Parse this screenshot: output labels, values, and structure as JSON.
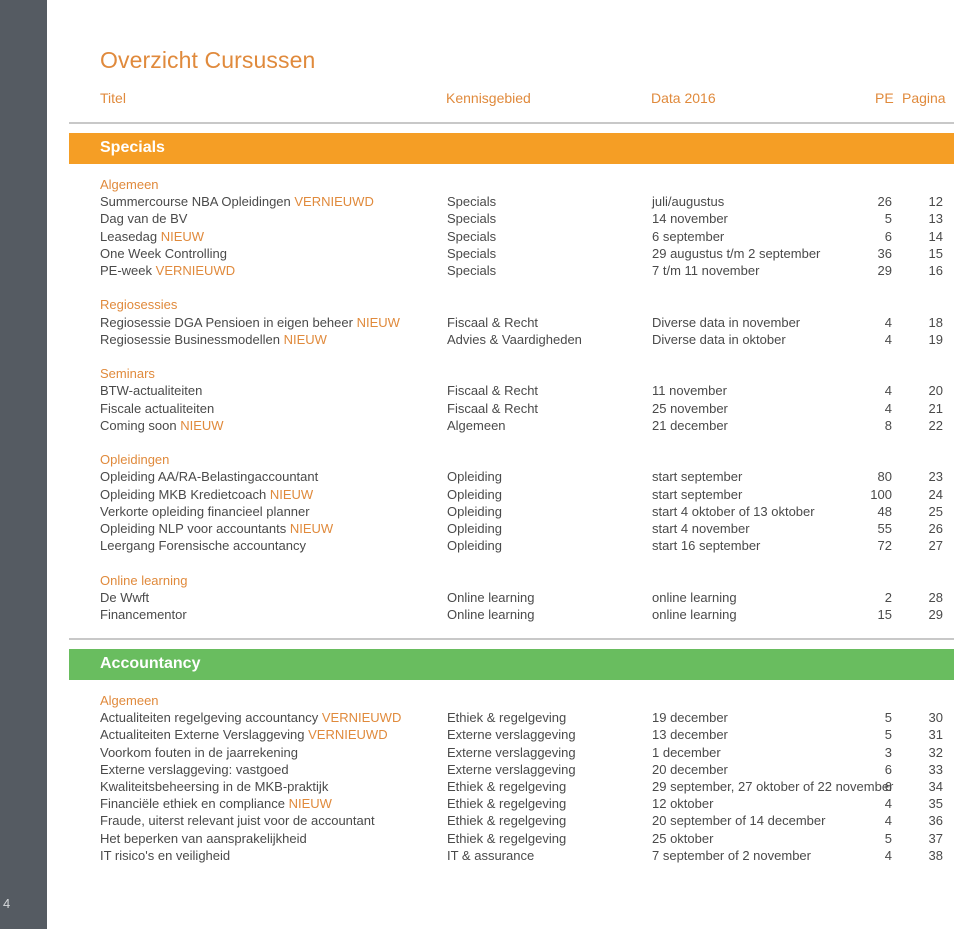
{
  "page_number": "4",
  "title": "Overzicht Cursussen",
  "columns": {
    "title": "Titel",
    "area": "Kennisgebied",
    "dates": "Data 2016",
    "pe": "PE",
    "page": "Pagina"
  },
  "colors": {
    "accent_orange": "#e08a3c",
    "specials_band": "#f59e25",
    "accountancy_band": "#69bd5f",
    "sidebar": "#555b62"
  },
  "sections": [
    {
      "name": "Specials",
      "groups": [
        {
          "name": "Algemeen",
          "rows": [
            {
              "title": "Summercourse NBA Opleidingen",
              "tag": "VERNIEUWD",
              "area": "Specials",
              "date": "juli/augustus",
              "pe": "26",
              "page": "12"
            },
            {
              "title": "Dag van de BV",
              "tag": "",
              "area": "Specials",
              "date": "14 november",
              "pe": "5",
              "page": "13"
            },
            {
              "title": "Leasedag",
              "tag": "NIEUW",
              "area": "Specials",
              "date": "6 september",
              "pe": "6",
              "page": "14"
            },
            {
              "title": "One Week Controlling",
              "tag": "",
              "area": "Specials",
              "date": "29 augustus t/m 2 september",
              "pe": "36",
              "page": "15"
            },
            {
              "title": "PE-week",
              "tag": "VERNIEUWD",
              "area": "Specials",
              "date": "7 t/m 11 november",
              "pe": "29",
              "page": "16"
            }
          ]
        },
        {
          "name": "Regiosessies",
          "rows": [
            {
              "title": "Regiosessie DGA Pensioen in eigen beheer",
              "tag": "NIEUW",
              "area": "Fiscaal & Recht",
              "date": "Diverse data in november",
              "pe": "4",
              "page": "18"
            },
            {
              "title": "Regiosessie Businessmodellen",
              "tag": "NIEUW",
              "area": "Advies & Vaardigheden",
              "date": "Diverse data in oktober",
              "pe": "4",
              "page": "19"
            }
          ]
        },
        {
          "name": "Seminars",
          "rows": [
            {
              "title": "BTW-actualiteiten",
              "tag": "",
              "area": "Fiscaal & Recht",
              "date": "11 november",
              "pe": "4",
              "page": "20"
            },
            {
              "title": "Fiscale actualiteiten",
              "tag": "",
              "area": "Fiscaal & Recht",
              "date": "25 november",
              "pe": "4",
              "page": "21"
            },
            {
              "title": "Coming soon",
              "tag": "NIEUW",
              "area": "Algemeen",
              "date": "21 december",
              "pe": "8",
              "page": "22"
            }
          ]
        },
        {
          "name": "Opleidingen",
          "rows": [
            {
              "title": "Opleiding AA/RA-Belastingaccountant",
              "tag": "",
              "area": "Opleiding",
              "date": "start september",
              "pe": "80",
              "page": "23"
            },
            {
              "title": "Opleiding MKB Kredietcoach",
              "tag": "NIEUW",
              "area": "Opleiding",
              "date": "start september",
              "pe": "100",
              "page": "24"
            },
            {
              "title": "Verkorte opleiding financieel planner",
              "tag": "",
              "area": "Opleiding",
              "date": "start 4 oktober of 13 oktober",
              "pe": "48",
              "page": "25"
            },
            {
              "title": "Opleiding NLP voor accountants",
              "tag": "NIEUW",
              "area": "Opleiding",
              "date": "start 4 november",
              "pe": "55",
              "page": "26"
            },
            {
              "title": "Leergang Forensische accountancy",
              "tag": "",
              "area": "Opleiding",
              "date": "start 16 september",
              "pe": "72",
              "page": "27"
            }
          ]
        },
        {
          "name": "Online learning",
          "rows": [
            {
              "title": "De Wwft",
              "tag": "",
              "area": "Online learning",
              "date": "online learning",
              "pe": "2",
              "page": "28"
            },
            {
              "title": "Financementor",
              "tag": "",
              "area": "Online learning",
              "date": "online learning",
              "pe": "15",
              "page": "29"
            }
          ]
        }
      ]
    },
    {
      "name": "Accountancy",
      "groups": [
        {
          "name": "Algemeen",
          "rows": [
            {
              "title": "Actualiteiten regelgeving accountancy",
              "tag": "VERNIEUWD",
              "area": "Ethiek & regelgeving",
              "date": "19 december",
              "pe": "5",
              "page": "30"
            },
            {
              "title": "Actualiteiten Externe Verslaggeving",
              "tag": "VERNIEUWD",
              "area": "Externe verslaggeving",
              "date": "13 december",
              "pe": "5",
              "page": "31"
            },
            {
              "title": "Voorkom fouten in de jaarrekening",
              "tag": "",
              "area": "Externe verslaggeving",
              "date": "1 december",
              "pe": "3",
              "page": "32"
            },
            {
              "title": "Externe verslaggeving: vastgoed",
              "tag": "",
              "area": "Externe verslaggeving",
              "date": "20 december",
              "pe": "6",
              "page": "33"
            },
            {
              "title": "Kwaliteitsbeheersing in de MKB-praktijk",
              "tag": "",
              "area": "Ethiek & regelgeving",
              "date": "29 september, 27 oktober of 22 november",
              "pe": "6",
              "page": "34"
            },
            {
              "title": "Financiële ethiek en compliance",
              "tag": "NIEUW",
              "area": "Ethiek & regelgeving",
              "date": "12 oktober",
              "pe": "4",
              "page": "35"
            },
            {
              "title": "Fraude, uiterst relevant juist voor de accountant",
              "tag": "",
              "area": "Ethiek & regelgeving",
              "date": "20 september of 14 december",
              "pe": "4",
              "page": "36"
            },
            {
              "title": "Het beperken van aansprakelijkheid",
              "tag": "",
              "area": "Ethiek & regelgeving",
              "date": "25 oktober",
              "pe": "5",
              "page": "37"
            },
            {
              "title": "IT risico's en veiligheid",
              "tag": "",
              "area": "IT & assurance",
              "date": "7 september of 2 november",
              "pe": "4",
              "page": "38"
            }
          ]
        }
      ]
    }
  ]
}
